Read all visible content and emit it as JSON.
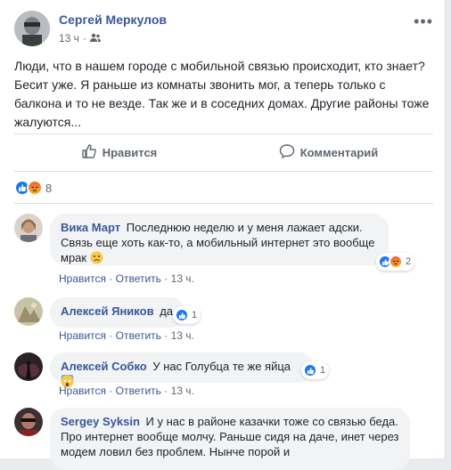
{
  "post": {
    "author": "Сергей Меркулов",
    "time": "13 ч",
    "text": "Люди, что в нашем городе с мобильной связью происходит, кто знает? Бесит уже. Я раньше из комнаты звонить мог, а теперь только с балкона и то не везде. Так же и в соседних домах. Другие районы тоже жалуются...",
    "like_label": "Нравится",
    "comment_label": "Комментарий",
    "reaction_count": "8"
  },
  "comments": [
    {
      "author": "Вика Март",
      "text": "Последнюю неделю и у меня лажает адски. Связь еще хоть как-то, а мобильный интернет это вообще мрак",
      "like_link": "Нравится",
      "reply_link": "Ответить",
      "time": "13 ч.",
      "reaction_count": "2"
    },
    {
      "author": "Алексей Яников",
      "text": "да",
      "like_link": "Нравится",
      "reply_link": "Ответить",
      "time": "13 ч.",
      "reaction_count": "1"
    },
    {
      "author": "Алексей Собко",
      "text": "У нас Голубца те же яйца",
      "like_link": "Нравится",
      "reply_link": "Ответить",
      "time": "13 ч.",
      "reaction_count": "1"
    },
    {
      "author": "Sergey Syksin",
      "text": "И у нас в районе казачки тоже со связью беда. Про интернет вообще молчу. Раньше сидя на даче, инет через модем ловил без проблем. Нынче порой и"
    }
  ],
  "colors": {
    "link": "#385898",
    "like_blue": "#1877f2",
    "bubble": "#f2f3f5"
  }
}
